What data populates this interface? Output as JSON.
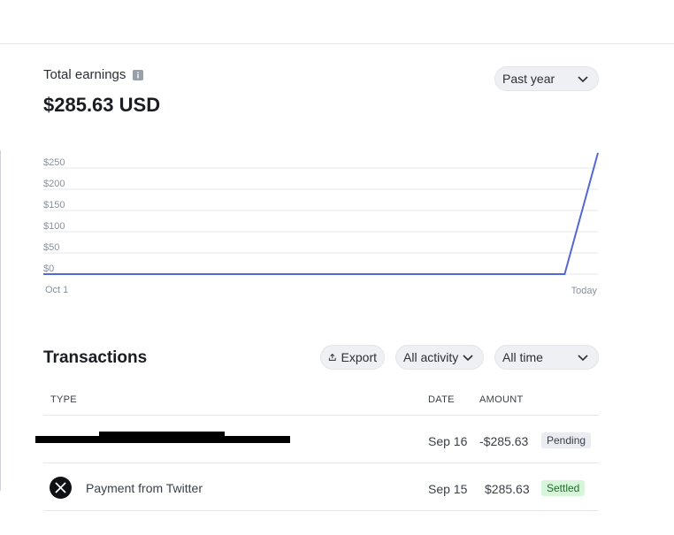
{
  "summary": {
    "label": "Total earnings",
    "amount": "$285.63 USD",
    "period_selector": "Past year"
  },
  "chart_data": {
    "type": "line",
    "x": [
      "Oct 1",
      "Today"
    ],
    "y_ticks": [
      "$250",
      "$200",
      "$150",
      "$100",
      "$50",
      "$0"
    ],
    "ylim": [
      0,
      250
    ],
    "grid": true,
    "series": [
      {
        "points": [
          [
            0,
            0
          ],
          [
            0.94,
            0
          ],
          [
            1,
            285.63
          ]
        ]
      }
    ],
    "color": "#5468d4"
  },
  "transactions": {
    "title": "Transactions",
    "export_label": "Export",
    "activity_filter": "All activity",
    "time_filter": "All time",
    "columns": {
      "type": "TYPE",
      "date": "DATE",
      "amount": "AMOUNT"
    },
    "rows": [
      {
        "type": "",
        "date": "Sep 16",
        "amount": "-$285.63",
        "status": "Pending"
      },
      {
        "type": "Payment from Twitter",
        "date": "Sep 15",
        "amount": "$285.63",
        "status": "Settled"
      }
    ]
  },
  "colors": {
    "line": "#5468d4",
    "pending_bg": "#e9ecf1",
    "settled_bg": "#d6f5d9"
  }
}
